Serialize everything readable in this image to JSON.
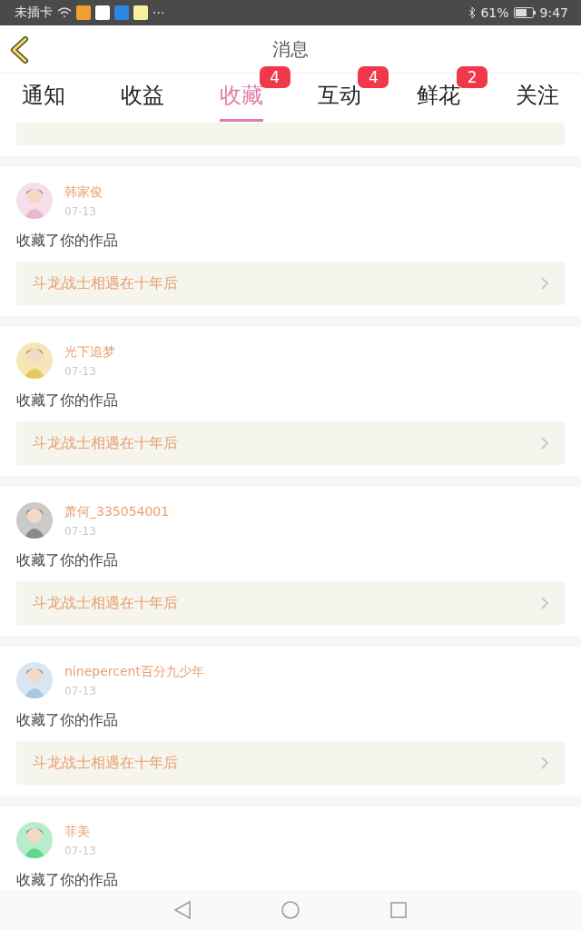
{
  "status_bar": {
    "carrier": "未插卡",
    "more": "···",
    "battery": "61%",
    "time": "9:47"
  },
  "header": {
    "title": "消息"
  },
  "tabs": [
    {
      "label": "通知",
      "selected": false
    },
    {
      "label": "收益",
      "selected": false
    },
    {
      "label": "收藏",
      "selected": true,
      "badge": "4"
    },
    {
      "label": "互动",
      "selected": false,
      "badge": "4"
    },
    {
      "label": "鲜花",
      "selected": false,
      "badge": "2"
    },
    {
      "label": "关注",
      "selected": false
    }
  ],
  "messages": [
    {
      "user": "韩家俊",
      "date": "07-13",
      "action": "收藏了你的作品",
      "work": "斗龙战士相遇在十年后"
    },
    {
      "user": "光下追梦",
      "date": "07-13",
      "action": "收藏了你的作品",
      "work": "斗龙战士相遇在十年后"
    },
    {
      "user": "萧何_335054001",
      "date": "07-13",
      "action": "收藏了你的作品",
      "work": "斗龙战士相遇在十年后"
    },
    {
      "user": "ninepercent百分九少年",
      "date": "07-13",
      "action": "收藏了你的作品",
      "work": "斗龙战士相遇在十年后"
    },
    {
      "user": "菲美",
      "date": "07-13",
      "action": "收藏了你的作品"
    }
  ]
}
